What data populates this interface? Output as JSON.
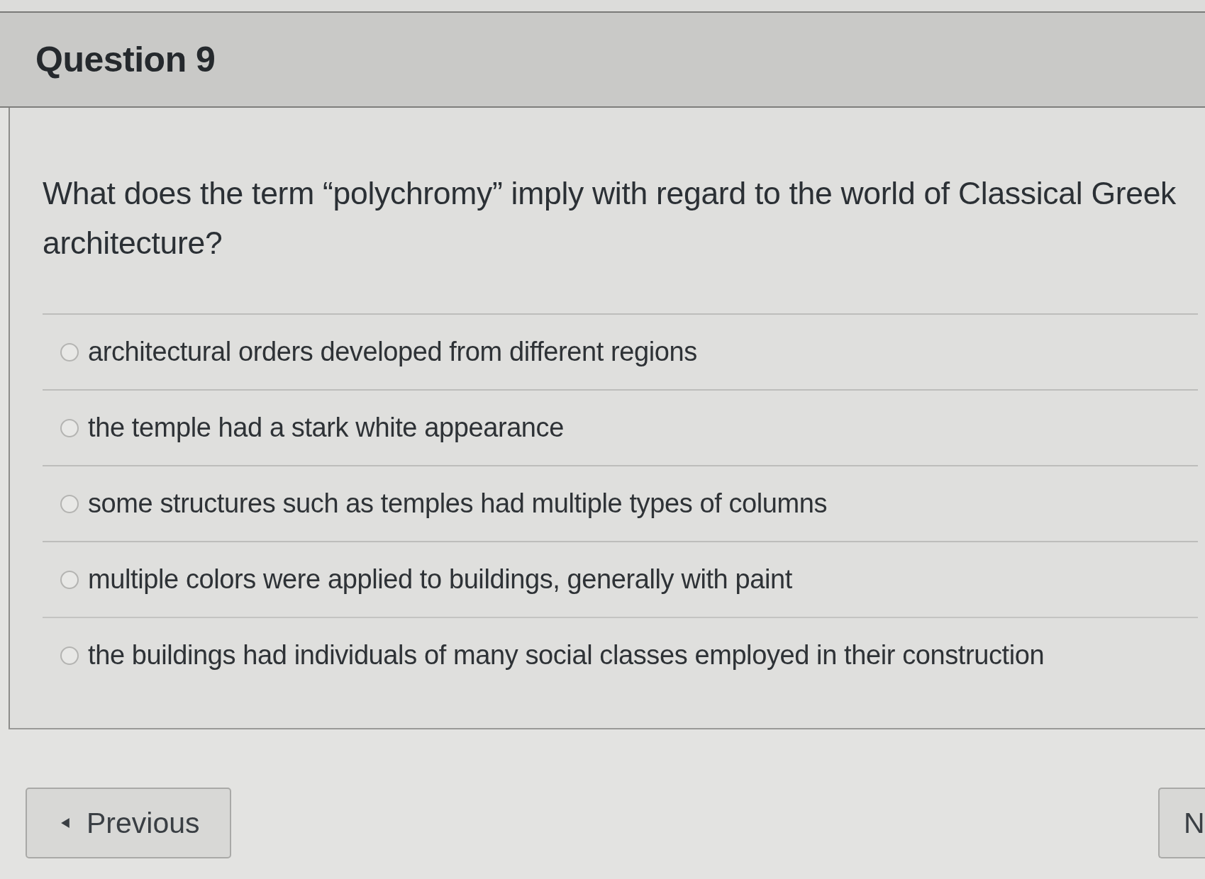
{
  "question": {
    "title": "Question 9",
    "text": "What does the term “polychromy” imply with regard to the world of Classical Greek architecture?"
  },
  "options": [
    {
      "label": "architectural orders developed from different regions",
      "selected": false
    },
    {
      "label": "the temple had a stark white appearance",
      "selected": false
    },
    {
      "label": "some structures such as temples had multiple types of columns",
      "selected": false
    },
    {
      "label": "multiple colors were applied to buildings, generally with paint",
      "selected": false
    },
    {
      "label": "the buildings had individuals of many social classes employed in their construction",
      "selected": false
    }
  ],
  "navigation": {
    "previous": "Previous",
    "next": "N"
  }
}
